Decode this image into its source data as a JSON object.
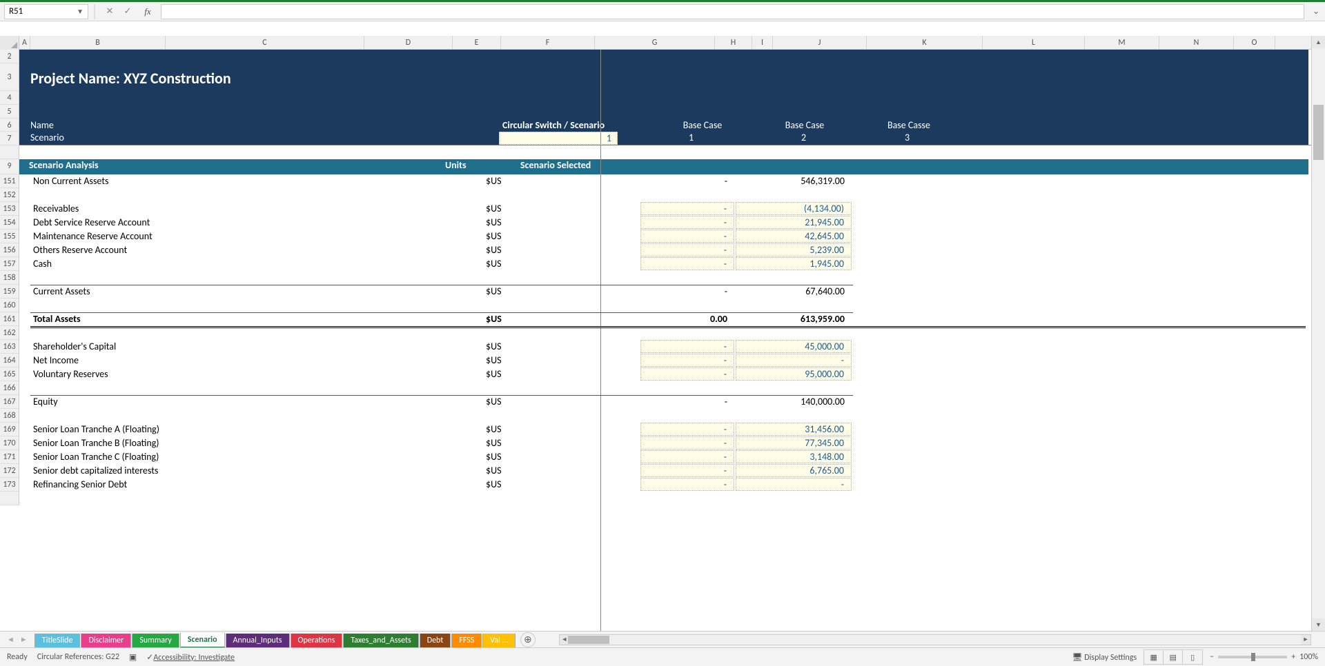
{
  "namebox": "R51",
  "cols": [
    "A",
    "B",
    "C",
    "D",
    "E",
    "F",
    "G",
    "H",
    "I",
    "J",
    "K",
    "L",
    "M",
    "N",
    "O"
  ],
  "frozenRowHdrs": [
    "2",
    "3",
    "4",
    "5",
    "6",
    "7",
    "",
    "9"
  ],
  "banner": {
    "title": "Project Name: XYZ Construction",
    "nameLabel": "Name",
    "circularSwitch": "Circular Switch / Scenario",
    "baseCases": [
      "Base Case",
      "Base Case",
      "Base Casse"
    ],
    "scenarioLabel": "Scenario",
    "scenarioValue": "1",
    "scenarioNums": [
      "1",
      "2",
      "3"
    ]
  },
  "section": {
    "title": "Scenario Analysis",
    "units": "Units",
    "selected": "Scenario Selected"
  },
  "rows": [
    {
      "rh": "151",
      "label": "Non Current Assets",
      "units": "$US",
      "j": "-",
      "k": "546,319.00",
      "type": "plain"
    },
    {
      "rh": "152",
      "type": "blank"
    },
    {
      "rh": "153",
      "label": "Receivables",
      "units": "$US",
      "j": "-",
      "k": "(4,134.00)",
      "type": "input",
      "neg": true
    },
    {
      "rh": "154",
      "label": "Debt Service Reserve Account",
      "units": "$US",
      "j": "-",
      "k": "21,945.00",
      "type": "input"
    },
    {
      "rh": "155",
      "label": "Maintenance Reserve Account",
      "units": "$US",
      "j": "-",
      "k": "42,645.00",
      "type": "input"
    },
    {
      "rh": "156",
      "label": "Others Reserve Account",
      "units": "$US",
      "j": "-",
      "k": "5,239.00",
      "type": "input"
    },
    {
      "rh": "157",
      "label": "Cash",
      "units": "$US",
      "j": "-",
      "k": "1,945.00",
      "type": "input"
    },
    {
      "rh": "158",
      "type": "blank"
    },
    {
      "rh": "159",
      "label": "Current Assets",
      "units": "$US",
      "j": "-",
      "k": "67,640.00",
      "type": "plain",
      "topline": true
    },
    {
      "rh": "160",
      "type": "blank"
    },
    {
      "rh": "161",
      "label": "Total Assets",
      "units": "$US",
      "j": "0.00",
      "k": "613,959.00",
      "type": "total",
      "topline": true,
      "dblline": true
    },
    {
      "rh": "162",
      "type": "blank"
    },
    {
      "rh": "163",
      "label": "Shareholder's Capital",
      "units": "$US",
      "j": "-",
      "k": "45,000.00",
      "type": "input"
    },
    {
      "rh": "164",
      "label": "Net Income",
      "units": "$US",
      "j": "-",
      "k": "-",
      "type": "input"
    },
    {
      "rh": "165",
      "label": "Voluntary Reserves",
      "units": "$US",
      "j": "-",
      "k": "95,000.00",
      "type": "input"
    },
    {
      "rh": "166",
      "type": "blank"
    },
    {
      "rh": "167",
      "label": "Equity",
      "units": "$US",
      "j": "-",
      "k": "140,000.00",
      "type": "plain",
      "topline": true
    },
    {
      "rh": "168",
      "type": "blank"
    },
    {
      "rh": "169",
      "label": "Senior Loan Tranche A (Floating)",
      "units": "$US",
      "j": "-",
      "k": "31,456.00",
      "type": "input"
    },
    {
      "rh": "170",
      "label": "Senior Loan Tranche B (Floating)",
      "units": "$US",
      "j": "-",
      "k": "77,345.00",
      "type": "input"
    },
    {
      "rh": "171",
      "label": "Senior Loan Tranche C (Floating)",
      "units": "$US",
      "j": "-",
      "k": "3,148.00",
      "type": "input"
    },
    {
      "rh": "172",
      "label": "Senior debt capitalized interests",
      "units": "$US",
      "j": "-",
      "k": "6,765.00",
      "type": "input"
    },
    {
      "rh": "173",
      "label": "Refinancing Senior Debt",
      "units": "$US",
      "j": "-",
      "k": "-",
      "type": "input"
    },
    {
      "rh": "",
      "type": "blank"
    }
  ],
  "tabs": [
    {
      "name": "TitleSlide",
      "color": "#5bc0de"
    },
    {
      "name": "Disclaimer",
      "color": "#e83e8c"
    },
    {
      "name": "Summary",
      "color": "#28a745"
    },
    {
      "name": "Scenario",
      "color": "#217346",
      "active": true
    },
    {
      "name": "Annual_Inputs",
      "color": "#5e2d79"
    },
    {
      "name": "Operations",
      "color": "#dc3545"
    },
    {
      "name": "Taxes_and_Assets",
      "color": "#2e7d32"
    },
    {
      "name": "Debt",
      "color": "#8b4513"
    },
    {
      "name": "FFSS",
      "color": "#ff8c00"
    },
    {
      "name": "Val",
      "color": "#ffc107",
      "trunc": "…"
    }
  ],
  "statusbar": {
    "ready": "Ready",
    "circular": "Circular References: G22",
    "accessibility": "Accessibility: Investigate",
    "display": "Display Settings",
    "zoom": "100%"
  }
}
